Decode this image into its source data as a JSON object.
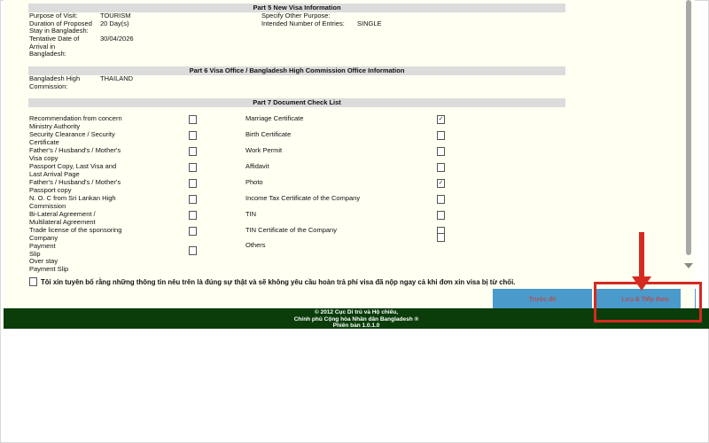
{
  "part5": {
    "header": "Part 5 New Visa Information",
    "purpose_label": "Purpose of Visit:",
    "purpose_value": "TOURISM",
    "duration_label": "Duration of Proposed\nStay in Bangladesh:",
    "duration_value": "20 Day(s)",
    "arrival_label": "Tentative Date of\nArrival in\nBangladesh:",
    "arrival_value": "30/04/2026",
    "other_purpose_label": "Specify Other Purpose:",
    "entries_label": "Intended Number of Entries:",
    "entries_value": "SINGLE"
  },
  "part6": {
    "header": "Part 6 Visa Office / Bangladesh High Commission Office Information",
    "commission_label": "Bangladesh High\nCommission:",
    "commission_value": "THAILAND"
  },
  "part7": {
    "header": "Part 7 Document Check List",
    "left_docs": [
      {
        "label": "Recommendation from concern\nMinistry Authority",
        "checked": false
      },
      {
        "label": "Security Clearance / Security\nCertificate",
        "checked": false
      },
      {
        "label": "Father's / Husband's / Mother's\nVisa copy",
        "checked": false
      },
      {
        "label": "Passport Copy, Last Visa and\nLast Arrival Page",
        "checked": false
      },
      {
        "label": "Father's / Husband's / Mother's\nPassport copy",
        "checked": false
      },
      {
        "label": "N. O. C from Sri Lankan High\nCommission",
        "checked": false
      },
      {
        "label": "Bi-Lateral Agreement /\nMultilateral Agreement",
        "checked": false
      },
      {
        "label": "Trade license of the sponsoring\nCompany",
        "checked": false
      },
      {
        "label": "Payment\nSlip",
        "checked": false
      },
      {
        "label": "Over stay\nPayment Slip",
        "checked": false
      }
    ],
    "right_docs": [
      {
        "label": "Marriage Certificate",
        "checked": true
      },
      {
        "label": "Birth Certificate",
        "checked": false
      },
      {
        "label": "Work Permit",
        "checked": false
      },
      {
        "label": "Affidavit",
        "checked": false
      },
      {
        "label": "Photo",
        "checked": true
      },
      {
        "label": "Income Tax Certificate of the Company",
        "checked": false
      },
      {
        "label": "TIN",
        "checked": false
      },
      {
        "label": "TIN Certificate of the Company",
        "checked": false
      },
      {
        "label": "Others",
        "checked": false
      }
    ],
    "check_mark": "✓"
  },
  "declaration": "Tôi xin tuyên bố rằng những thông tin nêu trên là đúng sự thật và sẽ không yêu cầu hoàn trả phí visa đã nộp ngay cả khi đơn xin visa bị từ chối.",
  "buttons": {
    "previous": "Trước đó",
    "save_continue": "Lưu & Tiếp theo"
  },
  "footer": {
    "line1": "© 2012 Cục Di trú và Hộ chiếu,",
    "line2": "Chính phủ Cộng hòa Nhân dân Bangladesh ®",
    "line3": "Phiên bản 1.0.1.0"
  },
  "colors": {
    "form_bg": "#fffff2",
    "section_header_bg": "#dcdcdc",
    "button_bg": "#4a9acb",
    "button_text": "#d9342b",
    "footer_bg": "#0a3d0a",
    "annotation_red": "#d42a1f"
  }
}
